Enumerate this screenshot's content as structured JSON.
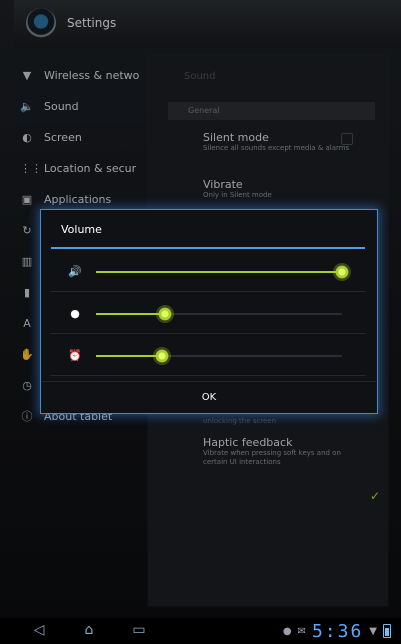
{
  "app": {
    "title": "Settings"
  },
  "sidebar": {
    "items": [
      {
        "label": "Wireless & netwo",
        "icon": "wifi-icon",
        "glyph": "▼"
      },
      {
        "label": "Sound",
        "icon": "speaker-icon",
        "glyph": "🔈",
        "selected": true
      },
      {
        "label": "Screen",
        "icon": "screen-icon",
        "glyph": "◐"
      },
      {
        "label": "Location & secur",
        "icon": "location-icon",
        "glyph": "⋮⋮"
      },
      {
        "label": "Applications",
        "icon": "applications-icon",
        "glyph": "▣"
      },
      {
        "label": "",
        "icon": "sync-icon",
        "glyph": "↻"
      },
      {
        "label": "",
        "icon": "storage-icon",
        "glyph": "▥"
      },
      {
        "label": "",
        "icon": "battery-icon",
        "glyph": "▮"
      },
      {
        "label": "",
        "icon": "language-icon",
        "glyph": "A"
      },
      {
        "label": "",
        "icon": "accessibility-icon",
        "glyph": "✋"
      },
      {
        "label": "",
        "icon": "clock-icon",
        "glyph": "◷"
      },
      {
        "label": "About tablet",
        "icon": "info-icon",
        "glyph": "ⓘ"
      }
    ]
  },
  "content": {
    "title": "Sound",
    "section": "General",
    "prefs": [
      {
        "title": "Silent mode",
        "summary": "Silence all sounds except media & alarms",
        "checked": false
      },
      {
        "title": "Vibrate",
        "summary": "Only in Silent mode"
      },
      {
        "title": "",
        "summary": "unlocking the screen"
      },
      {
        "title": "Haptic feedback",
        "summary": "Vibrate when pressing soft keys and on certain UI interactions",
        "checked": true
      }
    ]
  },
  "dialog": {
    "title": "Volume",
    "ok_label": "OK",
    "rows": [
      {
        "name": "media-volume",
        "icon": "speaker-icon",
        "glyph": "🔊",
        "level": 1.0
      },
      {
        "name": "notification-volume",
        "icon": "notification-icon",
        "glyph": "●",
        "level": 0.28
      },
      {
        "name": "alarm-volume",
        "icon": "alarm-icon",
        "glyph": "⏰",
        "level": 0.27
      }
    ]
  },
  "navbar": {
    "time": "5:36",
    "back_icon": "back-icon",
    "home_icon": "home-icon",
    "recent_icon": "recent-apps-icon",
    "status_icons": [
      "android-icon",
      "gmail-icon",
      "wifi-icon",
      "battery-icon"
    ]
  },
  "colors": {
    "accent": "#4f9ee7",
    "slider": "#a8cf2c",
    "background": "#121417"
  }
}
